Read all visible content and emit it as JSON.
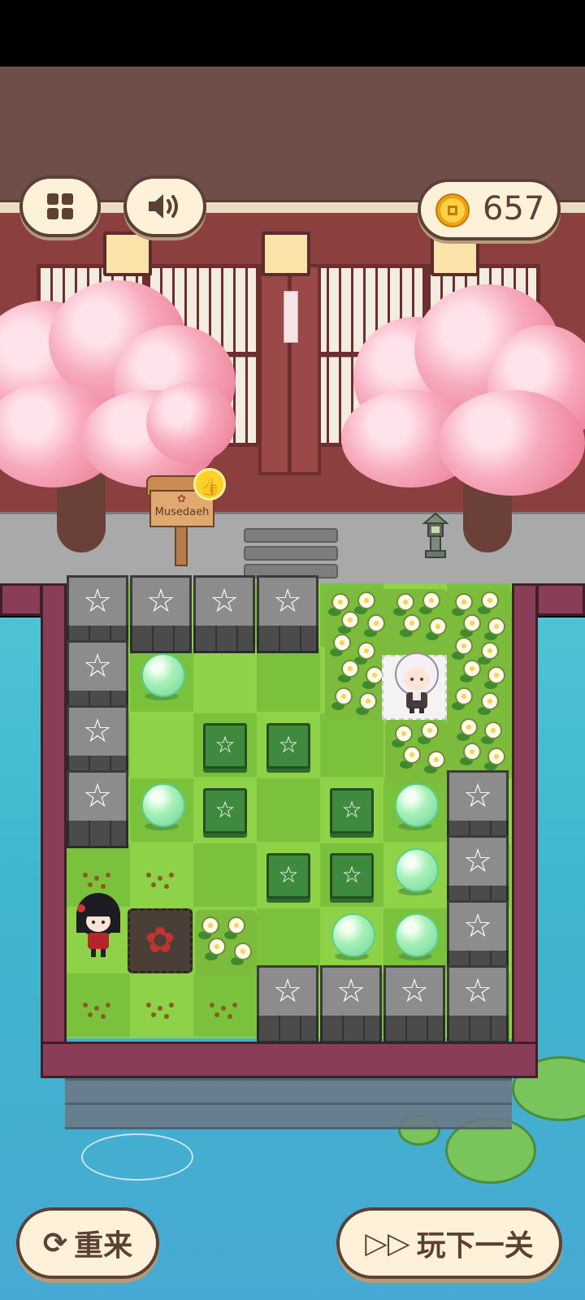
{
  "hud": {
    "menu_icon": "grid-icon",
    "sound_icon": "speaker-icon",
    "coins": "657",
    "coin_icon": "coin-icon"
  },
  "scene": {
    "sign_text": "Musedaeh",
    "sign_badge_icon": "thumbs-up-icon"
  },
  "board": {
    "grid_rows": 7,
    "grid_cols": 7,
    "cell_types": [
      "stone-block",
      "green-star-tile",
      "bubble",
      "flower-patch",
      "seed-patch",
      "dirt-blossom-tile",
      "white-mat"
    ]
  },
  "buttons": {
    "restart_label": "重来",
    "restart_icon": "restart-icon",
    "next_label": "玩下一关",
    "next_icon": "fast-forward-icon"
  },
  "colors": {
    "grass": "#8ed248",
    "border": "#8a3d57",
    "water": "#46a9d3",
    "button_bg": "#fdf2d9",
    "button_text": "#5d4035",
    "blossom": "#f7a9bb"
  }
}
